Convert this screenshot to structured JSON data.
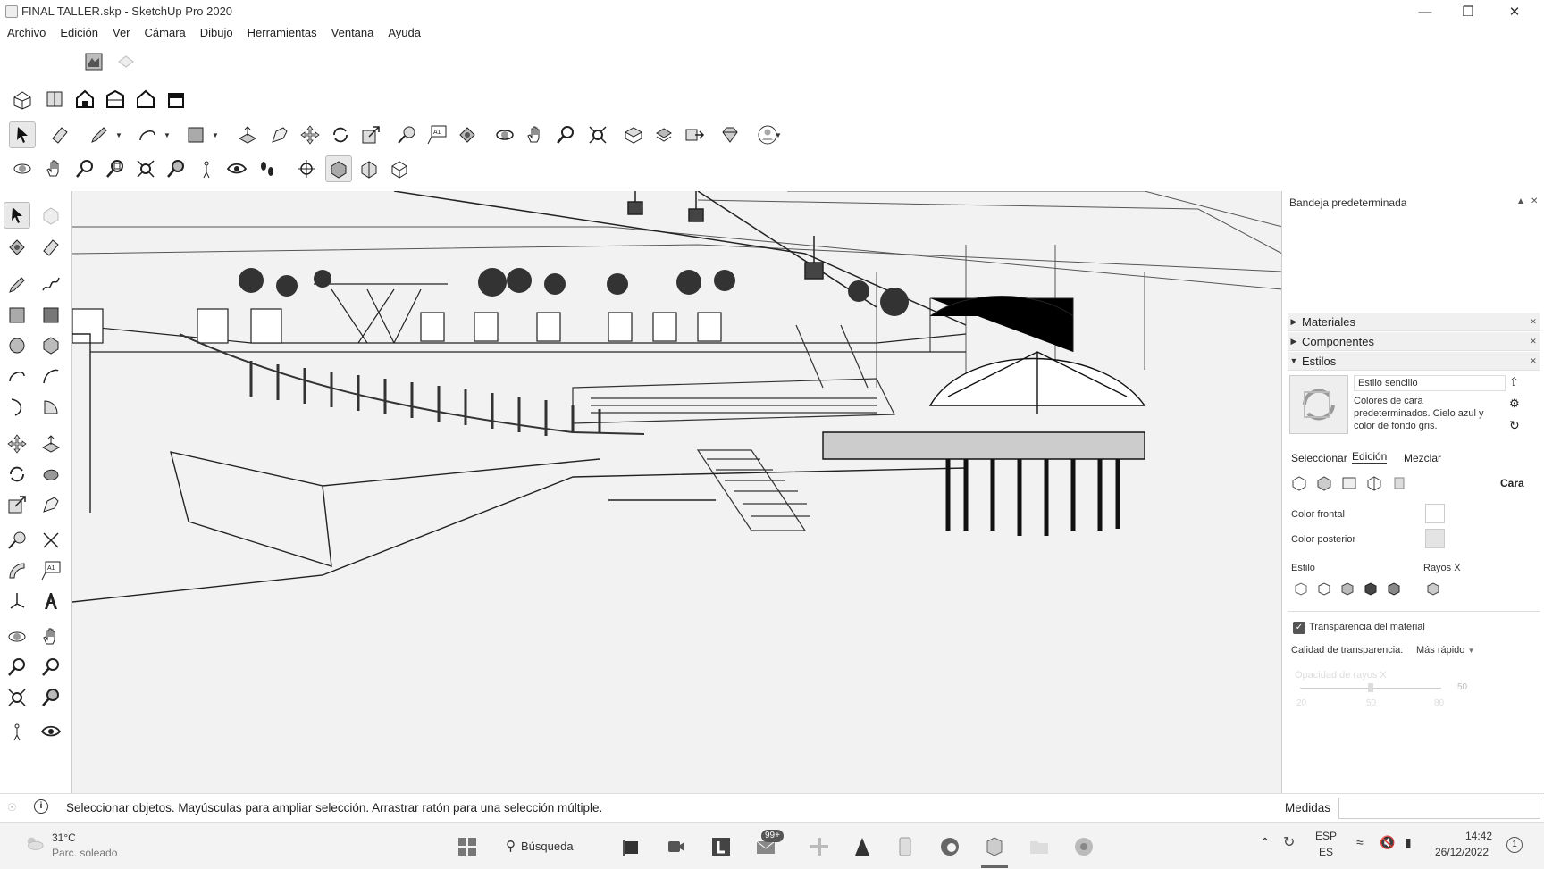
{
  "window": {
    "title": "FINAL TALLER.skp - SketchUp Pro 2020",
    "minimize_icon": "minimize-icon",
    "maximize_icon": "restore-icon",
    "close_icon": "close-icon"
  },
  "menu": {
    "items": [
      "Archivo",
      "Edición",
      "Ver",
      "Cámara",
      "Dibujo",
      "Herramientas",
      "Ventana",
      "Ayuda"
    ]
  },
  "tray": {
    "title": "Bandeja predeterminada",
    "sections": [
      "Materiales",
      "Componentes",
      "Estilos"
    ],
    "style_name": "Estilo sencillo",
    "style_description": "Colores de cara predeterminados. Cielo azul y color de fondo gris.",
    "tabs": [
      "Seleccionar",
      "Edición",
      "Mezclar"
    ],
    "face_label": "Cara",
    "front_color_label": "Color frontal",
    "back_color_label": "Color posterior",
    "front_color": "#ffffff",
    "back_color": "#e4e4e4",
    "style_label": "Estilo",
    "xray_label": "Rayos X",
    "material_transparency_label": "Transparencia del material",
    "transparency_quality_label": "Calidad de transparencia:",
    "transparency_quality_value": "Más rápido",
    "xray_opacity_label": "Opacidad de rayos X",
    "xray_opacity_value": "50",
    "slider_ticks": [
      "20",
      "50",
      "80"
    ]
  },
  "status": {
    "text": "Seleccionar objetos. Mayúsculas para ampliar selección. Arrastrar ratón para una selección múltiple.",
    "measurements_label": "Medidas"
  },
  "taskbar": {
    "weather_temp": "31°C",
    "weather_desc": "Parc. soleado",
    "search_label": "Búsqueda",
    "mail_badge": "99+",
    "language": "ESP",
    "keyboard": "ES",
    "time": "14:42",
    "date": "26/12/2022",
    "notifications": "1"
  }
}
